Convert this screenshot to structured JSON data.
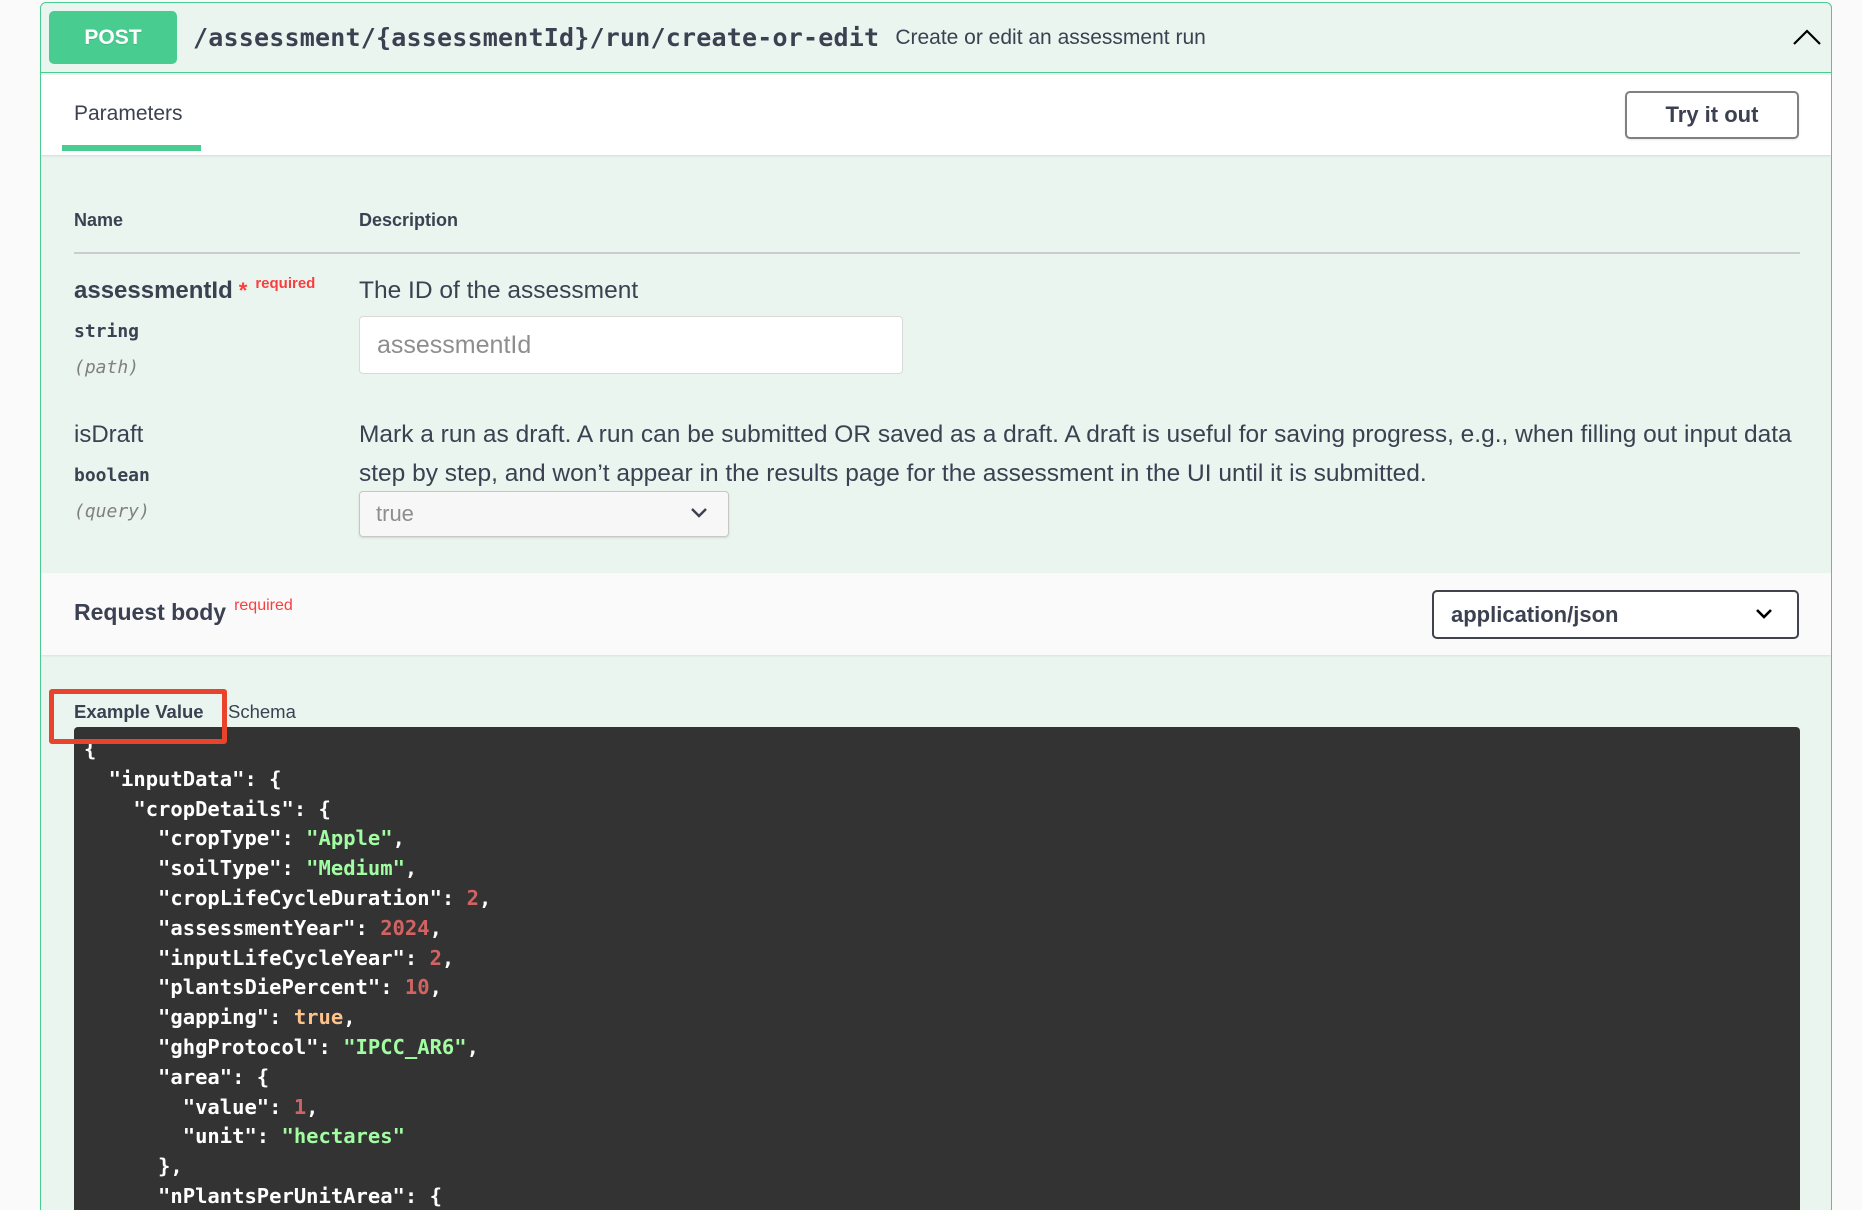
{
  "operation": {
    "method": "POST",
    "path": "/assessment/{assessmentId}/run/create-or-edit",
    "summary": "Create or edit an assessment run"
  },
  "tabs": {
    "parameters": "Parameters",
    "try_it_out": "Try it out"
  },
  "table": {
    "name_header": "Name",
    "description_header": "Description"
  },
  "params": [
    {
      "name": "assessmentId",
      "star": "*",
      "required": "required",
      "type": "string",
      "in": "(path)",
      "description": "The ID of the assessment",
      "placeholder": "assessmentId"
    },
    {
      "name": "isDraft",
      "type": "boolean",
      "in": "(query)",
      "description": "Mark a run as draft. A run can be submitted OR saved as a draft. A draft is useful for saving progress, e.g., when filling out input data step by step, and won’t appear in the results page for the assessment in the UI until it is submitted.",
      "selected": "true"
    }
  ],
  "request_body": {
    "title": "Request body",
    "required": "required",
    "content_type": "application/json",
    "example_tab": "Example Value",
    "schema_tab": "Schema"
  },
  "example_json": [
    [
      {
        "t": "{",
        "c": "p"
      }
    ],
    [
      {
        "t": "  \"inputData\": {",
        "c": "p"
      }
    ],
    [
      {
        "t": "    \"cropDetails\": {",
        "c": "p"
      }
    ],
    [
      {
        "t": "      \"cropType\": ",
        "c": "p"
      },
      {
        "t": "\"Apple\"",
        "c": "s"
      },
      {
        "t": ",",
        "c": "p"
      }
    ],
    [
      {
        "t": "      \"soilType\": ",
        "c": "p"
      },
      {
        "t": "\"Medium\"",
        "c": "s"
      },
      {
        "t": ",",
        "c": "p"
      }
    ],
    [
      {
        "t": "      \"cropLifeCycleDuration\": ",
        "c": "p"
      },
      {
        "t": "2",
        "c": "n"
      },
      {
        "t": ",",
        "c": "p"
      }
    ],
    [
      {
        "t": "      \"assessmentYear\": ",
        "c": "p"
      },
      {
        "t": "2024",
        "c": "n"
      },
      {
        "t": ",",
        "c": "p"
      }
    ],
    [
      {
        "t": "      \"inputLifeCycleYear\": ",
        "c": "p"
      },
      {
        "t": "2",
        "c": "n"
      },
      {
        "t": ",",
        "c": "p"
      }
    ],
    [
      {
        "t": "      \"plantsDiePercent\": ",
        "c": "p"
      },
      {
        "t": "10",
        "c": "n"
      },
      {
        "t": ",",
        "c": "p"
      }
    ],
    [
      {
        "t": "      \"gapping\": ",
        "c": "p"
      },
      {
        "t": "true",
        "c": "b"
      },
      {
        "t": ",",
        "c": "p"
      }
    ],
    [
      {
        "t": "      \"ghgProtocol\": ",
        "c": "p"
      },
      {
        "t": "\"IPCC_AR6\"",
        "c": "s"
      },
      {
        "t": ",",
        "c": "p"
      }
    ],
    [
      {
        "t": "      \"area\": {",
        "c": "p"
      }
    ],
    [
      {
        "t": "        \"value\": ",
        "c": "p"
      },
      {
        "t": "1",
        "c": "n"
      },
      {
        "t": ",",
        "c": "p"
      }
    ],
    [
      {
        "t": "        \"unit\": ",
        "c": "p"
      },
      {
        "t": "\"hectares\"",
        "c": "s"
      }
    ],
    [
      {
        "t": "      },",
        "c": "p"
      }
    ],
    [
      {
        "t": "      \"nPlantsPerUnitArea\": {",
        "c": "p"
      }
    ]
  ],
  "colors": {
    "post_accent": "#49cc90",
    "required_red": "#f93e3e",
    "highlight_red": "#e8442c",
    "code_bg": "#333333"
  },
  "icons": {
    "collapse": "chevron-up-icon",
    "dropdown": "chevron-down-icon"
  }
}
